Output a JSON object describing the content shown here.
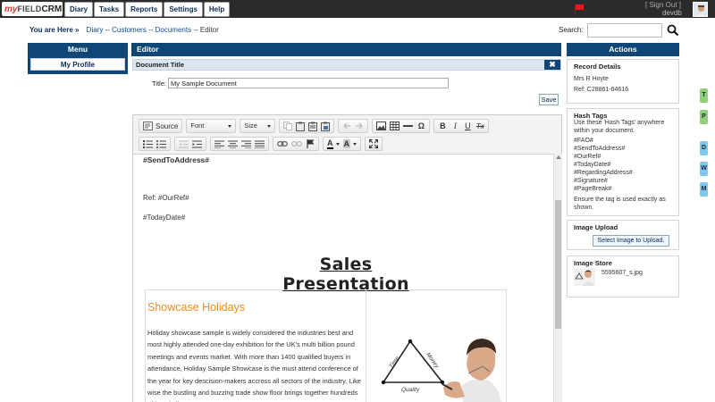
{
  "app": {
    "logo_my": "my",
    "logo_field": "FIELD",
    "logo_crm": "CRM",
    "nav": [
      "Diary",
      "Tasks",
      "Reports",
      "Settings",
      "Help"
    ],
    "sign_out": "[ Sign Out ]",
    "username": "devdb"
  },
  "breadcrumb": {
    "here": "You are Here »",
    "items": [
      "Diary",
      "Customers",
      "Documents",
      "Editor"
    ],
    "separator": "--"
  },
  "search": {
    "label": "Search:",
    "value": ""
  },
  "menu": {
    "title": "Menu",
    "items": [
      "My Profile"
    ]
  },
  "editor": {
    "header": "Editor",
    "doc_title_label": "Document Title",
    "close_glyph": "✖",
    "title_field_label": "Title:",
    "title_value": "My Sample Document",
    "save_label": "Save",
    "toolbar": {
      "source": "Source",
      "font": "Font",
      "size": "Size",
      "bold": "B",
      "italic": "I",
      "underline": "U",
      "omega": "Ω",
      "clear_format": "Tx",
      "font_color": "A",
      "bg_color": "A"
    },
    "content": {
      "send_to_address": "#SendToAddress#",
      "ref": "Ref: #OurRef#",
      "today": "#TodayDate#",
      "heading": "Sales Presentation",
      "showcase_title": "Showcase Holidays",
      "paragraph": "Holiday showcase sample is widely considered the industries best and most highly attended one-day exhibition for the UK's multi billion pound meetings and events market. With more than 1400 qualified buyers in attendance, Holiday Sample Showcase is the must attend conference of the year for key descision-makers accross all sectors of the industry. Like wise the bustling and buzzing trade show floor brings together hundreds of hospitality",
      "diagram_labels": [
        "Time",
        "Money",
        "Quality"
      ]
    }
  },
  "actions": {
    "header": "Actions",
    "record_details": {
      "title": "Record Details",
      "name": "Mrs R Hoyte",
      "ref": "Ref: C28861-64616"
    },
    "hash_tags": {
      "title": "Hash Tags",
      "intro_1": "Use these 'Hash Tags' anywhere",
      "intro_2": "within your document.",
      "tags": [
        "#FAO#",
        "#SendToAddress#",
        "#OurRef#",
        "#TodayDate#",
        "#RegardingAddress#",
        "#Signature#",
        "#PageBreak#"
      ],
      "note_1": "Ensure the tag is used exactly as",
      "note_2": "shown."
    },
    "image_upload": {
      "title": "Image Upload",
      "button": "Select Image to Upload."
    },
    "image_store": {
      "title": "Image Store",
      "file": "5595607_s.jpg"
    }
  },
  "side_tabs": [
    {
      "label": "T",
      "color": "#8fd07a"
    },
    {
      "label": "P",
      "color": "#8fd07a"
    },
    {
      "label": "D",
      "color": "#7ec9ef"
    },
    {
      "label": "W",
      "color": "#7ec9ef"
    },
    {
      "label": "M",
      "color": "#7ec9ef"
    }
  ],
  "colors": {
    "brand_blue": "#0f4676",
    "accent_orange": "#f08a1c",
    "topbar": "#2b2b2b"
  }
}
